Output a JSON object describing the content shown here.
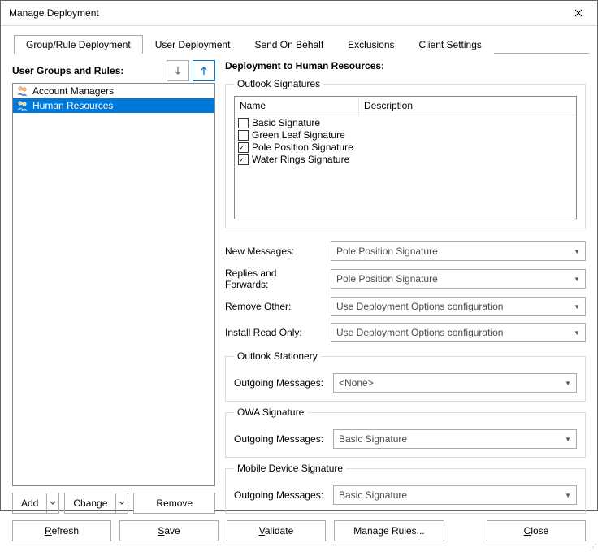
{
  "window": {
    "title": "Manage Deployment"
  },
  "tabs": {
    "items": [
      {
        "label": "Group/Rule Deployment"
      },
      {
        "label": "User Deployment"
      },
      {
        "label": "Send On Behalf"
      },
      {
        "label": "Exclusions"
      },
      {
        "label": "Client Settings"
      }
    ],
    "active_index": 0
  },
  "left": {
    "title": "User Groups and Rules:",
    "groups": [
      {
        "name": "Account Managers",
        "selected": false
      },
      {
        "name": "Human Resources",
        "selected": true
      }
    ],
    "buttons": {
      "add": "Add",
      "change": "Change",
      "remove": "Remove"
    }
  },
  "right": {
    "title": "Deployment to Human Resources:",
    "outlook_signatures": {
      "legend": "Outlook Signatures",
      "columns": {
        "name": "Name",
        "description": "Description"
      },
      "rows": [
        {
          "name": "Basic Signature",
          "checked": false
        },
        {
          "name": "Green Leaf Signature",
          "checked": false
        },
        {
          "name": "Pole Position Signature",
          "checked": true
        },
        {
          "name": "Water Rings Signature",
          "checked": true
        }
      ],
      "new_messages_label": "New Messages:",
      "new_messages_value": "Pole Position Signature",
      "replies_label": "Replies and Forwards:",
      "replies_value": "Pole Position Signature",
      "remove_other_label": "Remove Other:",
      "remove_other_value": "Use Deployment Options configuration",
      "install_ro_label": "Install Read Only:",
      "install_ro_value": "Use Deployment Options configuration"
    },
    "outlook_stationery": {
      "legend": "Outlook Stationery",
      "outgoing_label": "Outgoing Messages:",
      "outgoing_value": "<None>"
    },
    "owa_signature": {
      "legend": "OWA Signature",
      "outgoing_label": "Outgoing Messages:",
      "outgoing_value": "Basic Signature"
    },
    "mobile_signature": {
      "legend": "Mobile Device Signature",
      "outgoing_label": "Outgoing Messages:",
      "outgoing_value": "Basic Signature"
    }
  },
  "bottom": {
    "refresh": "Refresh",
    "save": "Save",
    "validate": "Validate",
    "manage_rules": "Manage Rules...",
    "close": "Close"
  }
}
